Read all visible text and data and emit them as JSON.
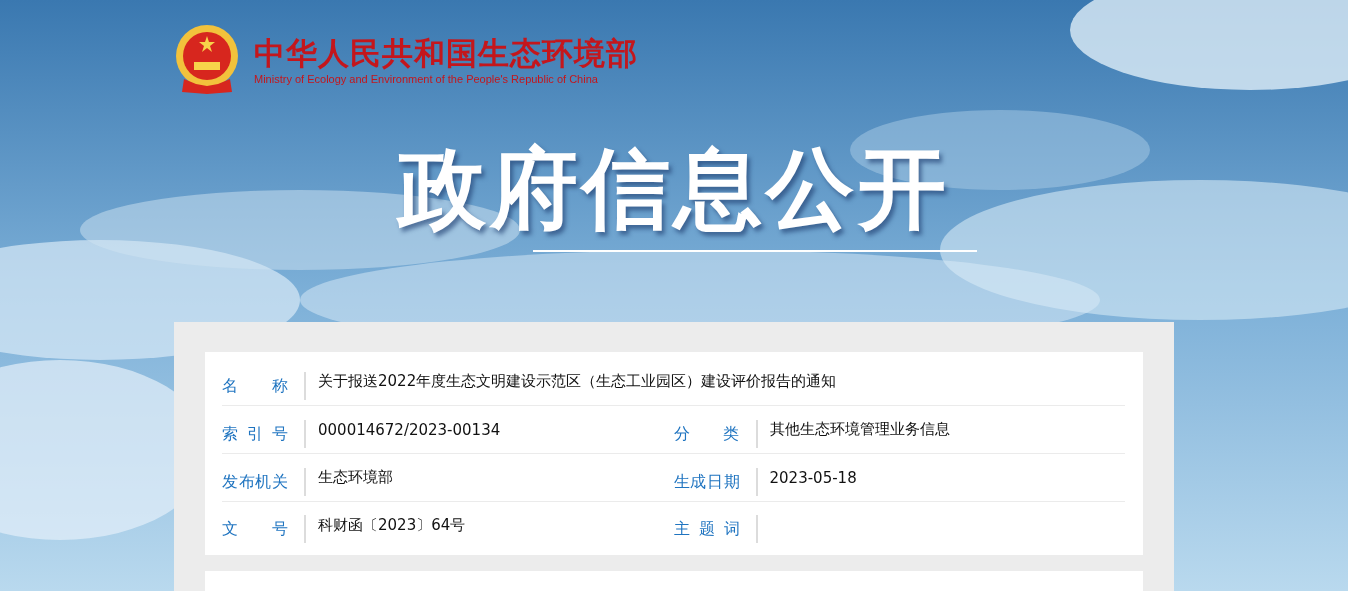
{
  "header": {
    "name_cn": "中华人民共和国生态环境部",
    "name_en": "Ministry of Ecology and Environment of the People's Republic of China"
  },
  "banner_title": "政府信息公开",
  "info_rows": [
    [
      {
        "label": "名 称",
        "value": "关于报送2022年度生态文明建设示范区（生态工业园区）建设评价报告的通知"
      }
    ],
    [
      {
        "label": "索 引 号",
        "value": "000014672/2023-00134"
      },
      {
        "label": "分 类",
        "value": "其他生态环境管理业务信息"
      }
    ],
    [
      {
        "label": "发布机关",
        "value": "生态环境部"
      },
      {
        "label": "生成日期",
        "value": "2023-05-18"
      }
    ],
    [
      {
        "label": "文 号",
        "value": "科财函〔2023〕64号"
      },
      {
        "label": "主 题 词"
      }
    ]
  ]
}
